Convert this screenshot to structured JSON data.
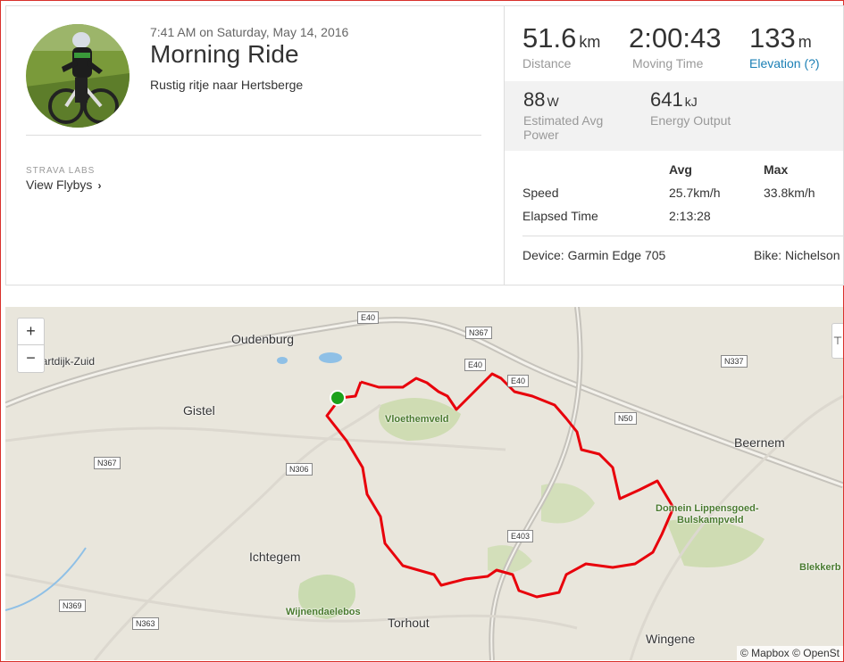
{
  "activity": {
    "date": "7:41 AM on Saturday, May 14, 2016",
    "title": "Morning Ride",
    "description": "Rustig ritje naar Hertsberge"
  },
  "labs": {
    "heading": "STRAVA LABS",
    "link": "View Flybys",
    "chevron": "›"
  },
  "stats": {
    "distance": {
      "value": "51.6",
      "unit": "km",
      "label": "Distance"
    },
    "moving_time": {
      "value": "2:00:43",
      "label": "Moving Time"
    },
    "elevation": {
      "value": "133",
      "unit": "m",
      "label": "Elevation (?)"
    },
    "power": {
      "value": "88",
      "unit": "W",
      "label": "Estimated Avg Power"
    },
    "energy": {
      "value": "641",
      "unit": "kJ",
      "label": "Energy Output"
    }
  },
  "table": {
    "headers": [
      "Avg",
      "Max"
    ],
    "rows": [
      {
        "label": "Speed",
        "avg": "25.7km/h",
        "max": "33.8km/h"
      },
      {
        "label": "Elapsed Time",
        "avg": "2:13:28",
        "max": ""
      }
    ]
  },
  "device": {
    "device": "Device: Garmin Edge 705",
    "bike": "Bike: Nichelson"
  },
  "map": {
    "zoom_in": "+",
    "zoom_out": "−",
    "attribution": "© Mapbox © OpenSt",
    "places": [
      "Oudenburg",
      "Gistel",
      "Vloethemveld",
      "Beernem",
      "Domein Lippensgoed-",
      "Bulskampveld",
      "Ichtegem",
      "Wijnendaelebos",
      "Torhout",
      "Wingene",
      "Blekkerb",
      "vaartdijk-Zuid"
    ],
    "roads": [
      "E40",
      "N367",
      "E40",
      "E40",
      "N337",
      "N50",
      "N367",
      "N306",
      "E403",
      "N369",
      "N363"
    ],
    "route_color": "#e8000b"
  }
}
